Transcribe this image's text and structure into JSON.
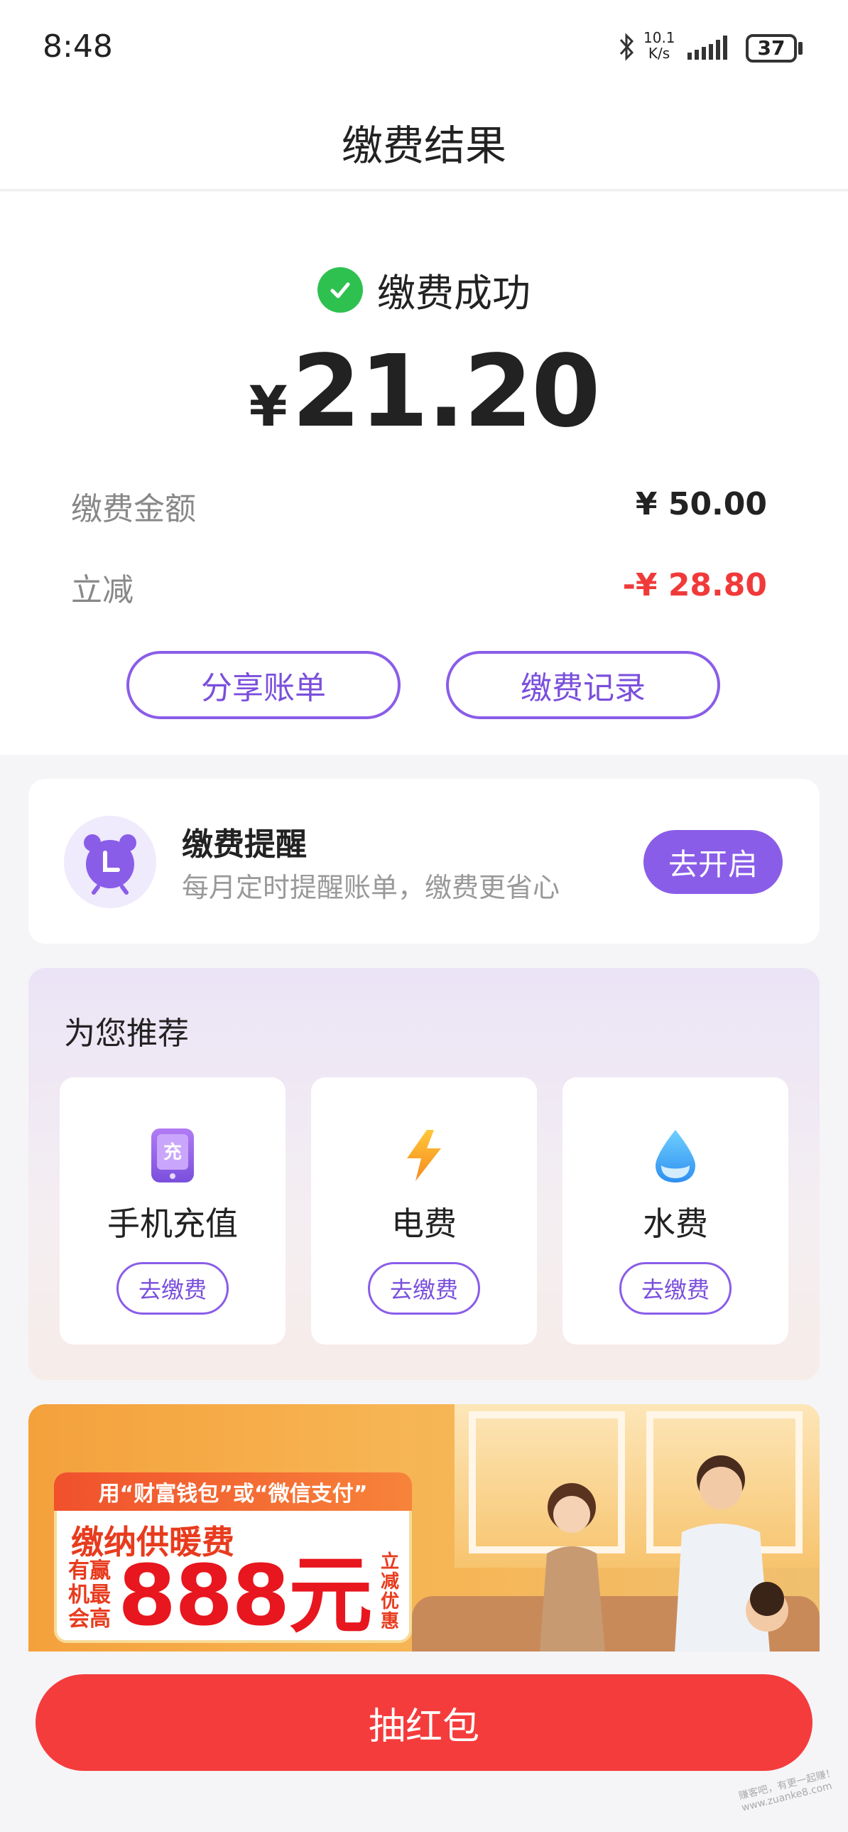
{
  "status_bar": {
    "time": "8:48",
    "net_speed_value": "10.1",
    "net_speed_unit": "K/s",
    "battery": "37"
  },
  "header": {
    "title": "缴费结果"
  },
  "result": {
    "status_text": "缴费成功",
    "currency_symbol": "¥",
    "amount": "21.20",
    "rows": [
      {
        "label": "缴费金额",
        "value": "¥ 50.00"
      },
      {
        "label": "立减",
        "value": "-¥ 28.80"
      }
    ],
    "buttons": {
      "share": "分享账单",
      "records": "缴费记录"
    }
  },
  "reminder": {
    "title": "缴费提醒",
    "desc": "每月定时提醒账单，缴费更省心",
    "button": "去开启"
  },
  "recommend": {
    "title": "为您推荐",
    "items": [
      {
        "label": "手机充值",
        "icon": "phone-recharge-icon",
        "icon_glyph": "充",
        "button": "去缴费"
      },
      {
        "label": "电费",
        "icon": "lightning-icon",
        "button": "去缴费"
      },
      {
        "label": "水费",
        "icon": "water-drop-icon",
        "button": "去缴费"
      }
    ]
  },
  "banner": {
    "line1": "用“财富钱包”或“微信支付”",
    "line2": "缴纳供暖费",
    "small_left": [
      "有赢",
      "机最",
      "会高"
    ],
    "big": "888元",
    "side": "立减优惠"
  },
  "bottom": {
    "button": "抽红包"
  },
  "watermark": "赚客吧，有更一起赚！ www.zuanke8.com",
  "colors": {
    "accent": "#8a5de8",
    "success": "#2fc150",
    "discount": "#f03a3a",
    "primary_button": "#f53c3c"
  }
}
